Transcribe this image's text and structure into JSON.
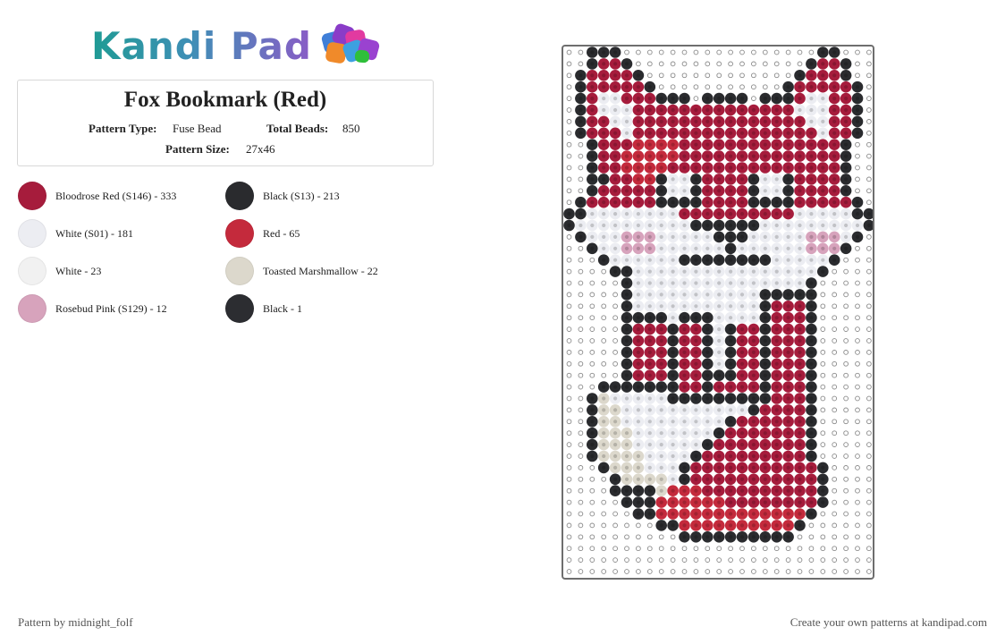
{
  "brand": {
    "name": "Kandi Pad"
  },
  "pattern": {
    "title": "Fox Bookmark (Red)",
    "type_label": "Pattern Type:",
    "type_value": "Fuse Bead",
    "beads_label": "Total Beads:",
    "beads_value": "850",
    "size_label": "Pattern Size:",
    "size_value": "27x46"
  },
  "colors": {
    "bloodrose": "#a61c3c",
    "white_s01": "#ecedf2",
    "black": "#2a2b2e",
    "red": "#c42a3c",
    "white": "#f1f1f1",
    "toasted": "#dcd8cc",
    "rosebud": "#d7a3bc",
    "peg": "#ffffff",
    "peg_ring": "#8a8a8a"
  },
  "legend": [
    {
      "label": "Bloodrose Red (S146) - 333",
      "color": "#a61c3c"
    },
    {
      "label": "Black (S13) - 213",
      "color": "#2a2b2e"
    },
    {
      "label": "White (S01) - 181",
      "color": "#ecedf2"
    },
    {
      "label": "Red - 65",
      "color": "#c42a3c"
    },
    {
      "label": "White - 23",
      "color": "#f1f1f1"
    },
    {
      "label": "Toasted Marshmallow - 22",
      "color": "#dcd8cc"
    },
    {
      "label": "Rosebud Pink (S129) - 12",
      "color": "#d7a3bc"
    },
    {
      "label": "Black - 1",
      "color": "#2c2d31"
    }
  ],
  "grid": {
    "cols": 27,
    "rows": 46,
    "cells": [
      "..BBB.................BB...",
      "..BRRB...............BRRB..",
      ".BRRRRB.............BRRRB..",
      ".BRRRRRB...........BRRRRRB.",
      ".BRWWRRRBBB.BBBB.BBBRWWRRB.",
      ".BRWWWRRRRRRRRRRRRRRWWWRRB.",
      ".BRRWWRRRRRRRRRRRRRRRWWRRB.",
      ".BRRRWRRRRRRRRRRRRRRRRWRRB.",
      "..BRRRxxxxRRRRRRRRRRRRRRB..",
      "..BRRxxxxxRRRRRRRRRRRRRRB..",
      "..BRRxxxxRRRRRRRRRRRRRRRB..",
      "..BBRRxxBWWBRRRRBWWBRRRRB..",
      "..BRRRRRBWWBRRRRBWWBRRRRB..",
      ".BRRRRRRBBBBRRRRBBBBRRRRRB.",
      "BBWWWWWWWWRRRRRRRRRRWWWWWBB",
      "BWWWWWWWWWWBBBBBBWWWWWWWWWB",
      ".BWWWPPPWWWWWBBBWWWWWPPPWB.",
      "..BWWPPPWWWWWWBWWWWWWPPPB..",
      "...BWWWWWWBBBBBBBBWWWWWB...",
      "....BBWWWWWWWWWWWWWWWWB....",
      ".....BWWWWWWWWWWWWWWWB.....",
      ".....BWWWWWWWWWWWBBBBB.....",
      ".....BWWWWWWWWWWWBRRRB.....",
      ".....BBBBWBBBWWWWBRRRB.....",
      ".....BRRRBRRBWBRRBRRRB.....",
      ".....BRRRBRRBWBRRBRRRB.....",
      ".....BRRRBRRBWBRRBRRRB.....",
      ".....BRRRBRRBWBRRBRRRB.....",
      ".....BRRRBRRBBBRRBRRRB.....",
      "...BBBBBBBRRBRRRRBRRRB.....",
      "..BTWWWWWBBBBBBBBBRRRB.....",
      "..BTTWWWWWWWWWWWBRRRRB.....",
      "..BTTWWWWWWWWWBRRRRRRB.....",
      "..BTTTWWWWWWWBRRRRRRRB.....",
      "..BTTTWWWWWWBRRRRRRRRB.....",
      "..BTTTTWWWWBRRRRRRRRRB.....",
      "...BTTTWWWBRRRRRRRRRRRB....",
      "....BTTTTWBRRRRRRRRRRRB....",
      "....BBBBTxxxRRRRRRRRRRB....",
      ".....BBBxxxxxxRRRRRRRRB....",
      "......BBxxxxxxxxxxxxxB.....",
      "........BBxxxxxxxxxxB......",
      "..........BBBBBBBBBB.......",
      "...........................",
      "...........................",
      "..........................."
    ]
  },
  "footer": {
    "credit": "Pattern by midnight_folf",
    "cta": "Create your own patterns at kandipad.com"
  }
}
